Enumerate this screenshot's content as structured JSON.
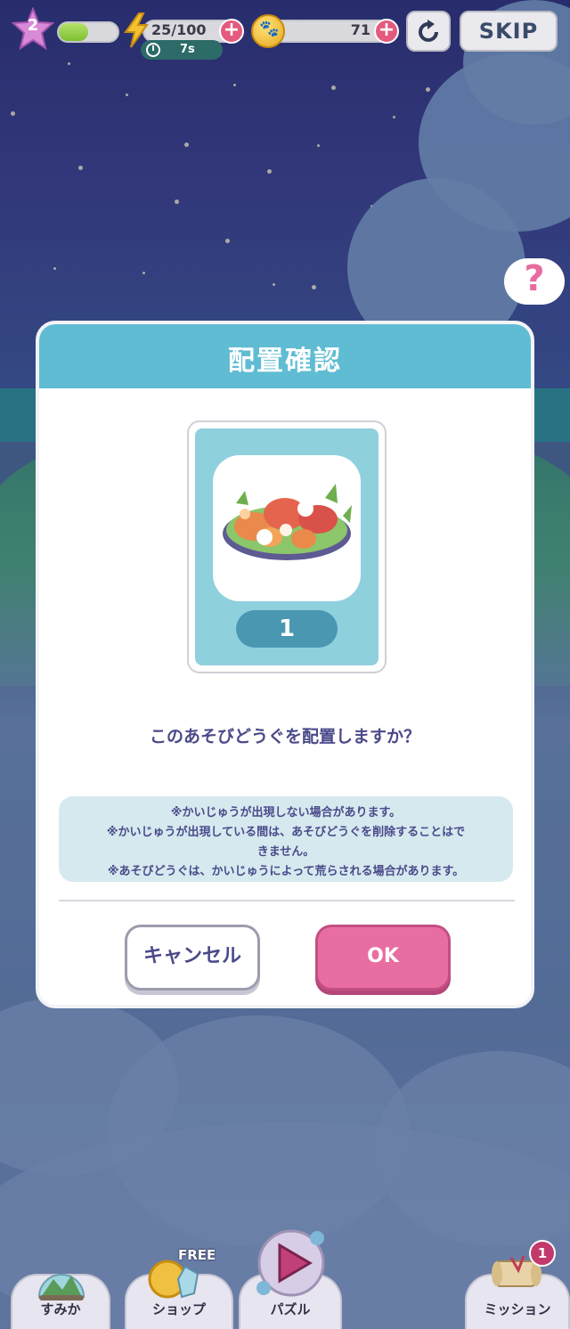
{
  "hud": {
    "level": "2",
    "xp_progress": 0.5,
    "energy": "25/100",
    "energy_timer": "7s",
    "coins": "71",
    "plus_symbol": "+",
    "skip_label": "SKIP",
    "help_symbol": "?"
  },
  "dialog": {
    "title": "配置確認",
    "item_quantity": "1",
    "question": "このあそびどうぐを配置しますか？",
    "notice_lines": [
      "※かいじゅうが出現しない場合があります。",
      "※かいじゅうが出現している間は、あそびどうぐを削除することはで",
      "きません。",
      "※あそびどうぐは、かいじゅうによって荒らされる場合があります。"
    ],
    "cancel_label": "キャンセル",
    "ok_label": "OK"
  },
  "nav": {
    "items": [
      {
        "label": "すみか"
      },
      {
        "label": "ショップ",
        "tag": "FREE"
      },
      {
        "label": "パズル"
      },
      {
        "label": "ミッション",
        "badge": "1"
      }
    ]
  },
  "colors": {
    "header": "#5fbcd3",
    "ok_button": "#e86ea2",
    "text": "#4a4a8a"
  }
}
